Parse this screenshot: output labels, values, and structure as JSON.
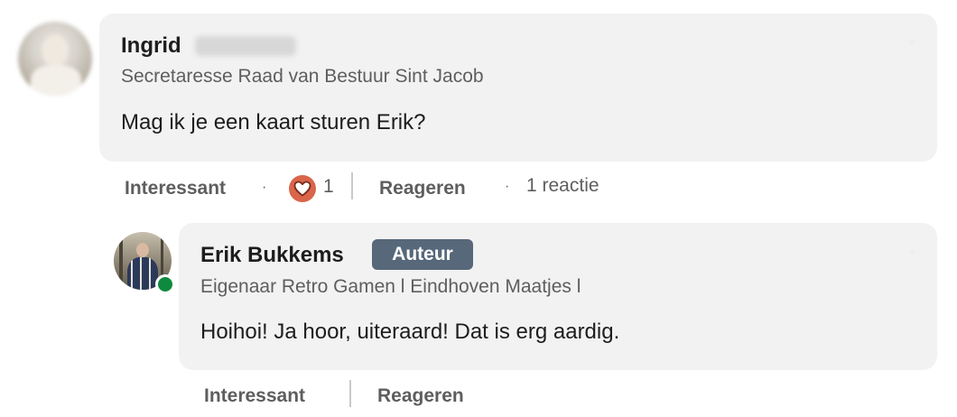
{
  "comment": {
    "author_first_name": "Ingrid",
    "headline": "Secretaresse Raad van Bestuur Sint Jacob",
    "message": "Mag ik je een kaart sturen Erik?",
    "actions": {
      "like_label": "Interessant",
      "separator": "·",
      "reaction_count": "1",
      "reply_label": "Reageren",
      "reply_count_text": "1 reactie"
    }
  },
  "reply": {
    "author_name": "Erik Bukkems",
    "author_badge": "Auteur",
    "headline": "Eigenaar Retro Gamen l Eindhoven Maatjes l",
    "message": "Hoihoi! Ja hoor, uiteraard! Dat is erg aardig.",
    "actions": {
      "like_label": "Interessant",
      "reply_label": "Reageren"
    }
  },
  "icons": {
    "reaction": "heart-icon",
    "presence": "online-status-icon"
  },
  "colors": {
    "bubble": "#f2f2f2",
    "badge": "#56687a",
    "heart": "#d9654a",
    "online": "#0e8a3e"
  }
}
